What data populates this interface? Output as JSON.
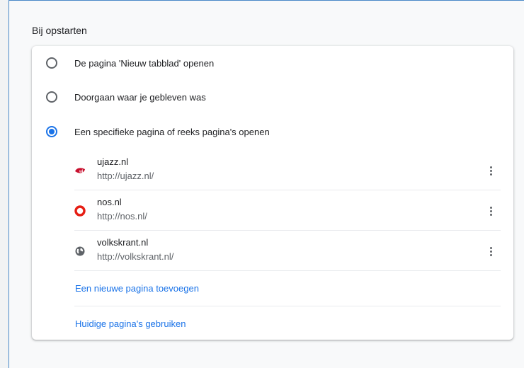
{
  "section": {
    "title": "Bij opstarten"
  },
  "startup_options": [
    {
      "label": "De pagina 'Nieuw tabblad' openen",
      "selected": false
    },
    {
      "label": "Doorgaan waar je gebleven was",
      "selected": false
    },
    {
      "label": "Een specifieke pagina of reeks pagina's openen",
      "selected": true
    }
  ],
  "pages": [
    {
      "name": "ujazz.nl",
      "url": "http://ujazz.nl/",
      "icon": "ujazz-favicon-icon"
    },
    {
      "name": "nos.nl",
      "url": "http://nos.nl/",
      "icon": "nos-favicon-icon"
    },
    {
      "name": "volkskrant.nl",
      "url": "http://volkskrant.nl/",
      "icon": "globe-icon"
    }
  ],
  "actions": {
    "add_page": "Een nieuwe pagina toevoegen",
    "use_current": "Huidige pagina's gebruiken"
  },
  "colors": {
    "accent": "#1a73e8",
    "nos_red": "#e61e14",
    "ujazz_red": "#c8102e"
  }
}
